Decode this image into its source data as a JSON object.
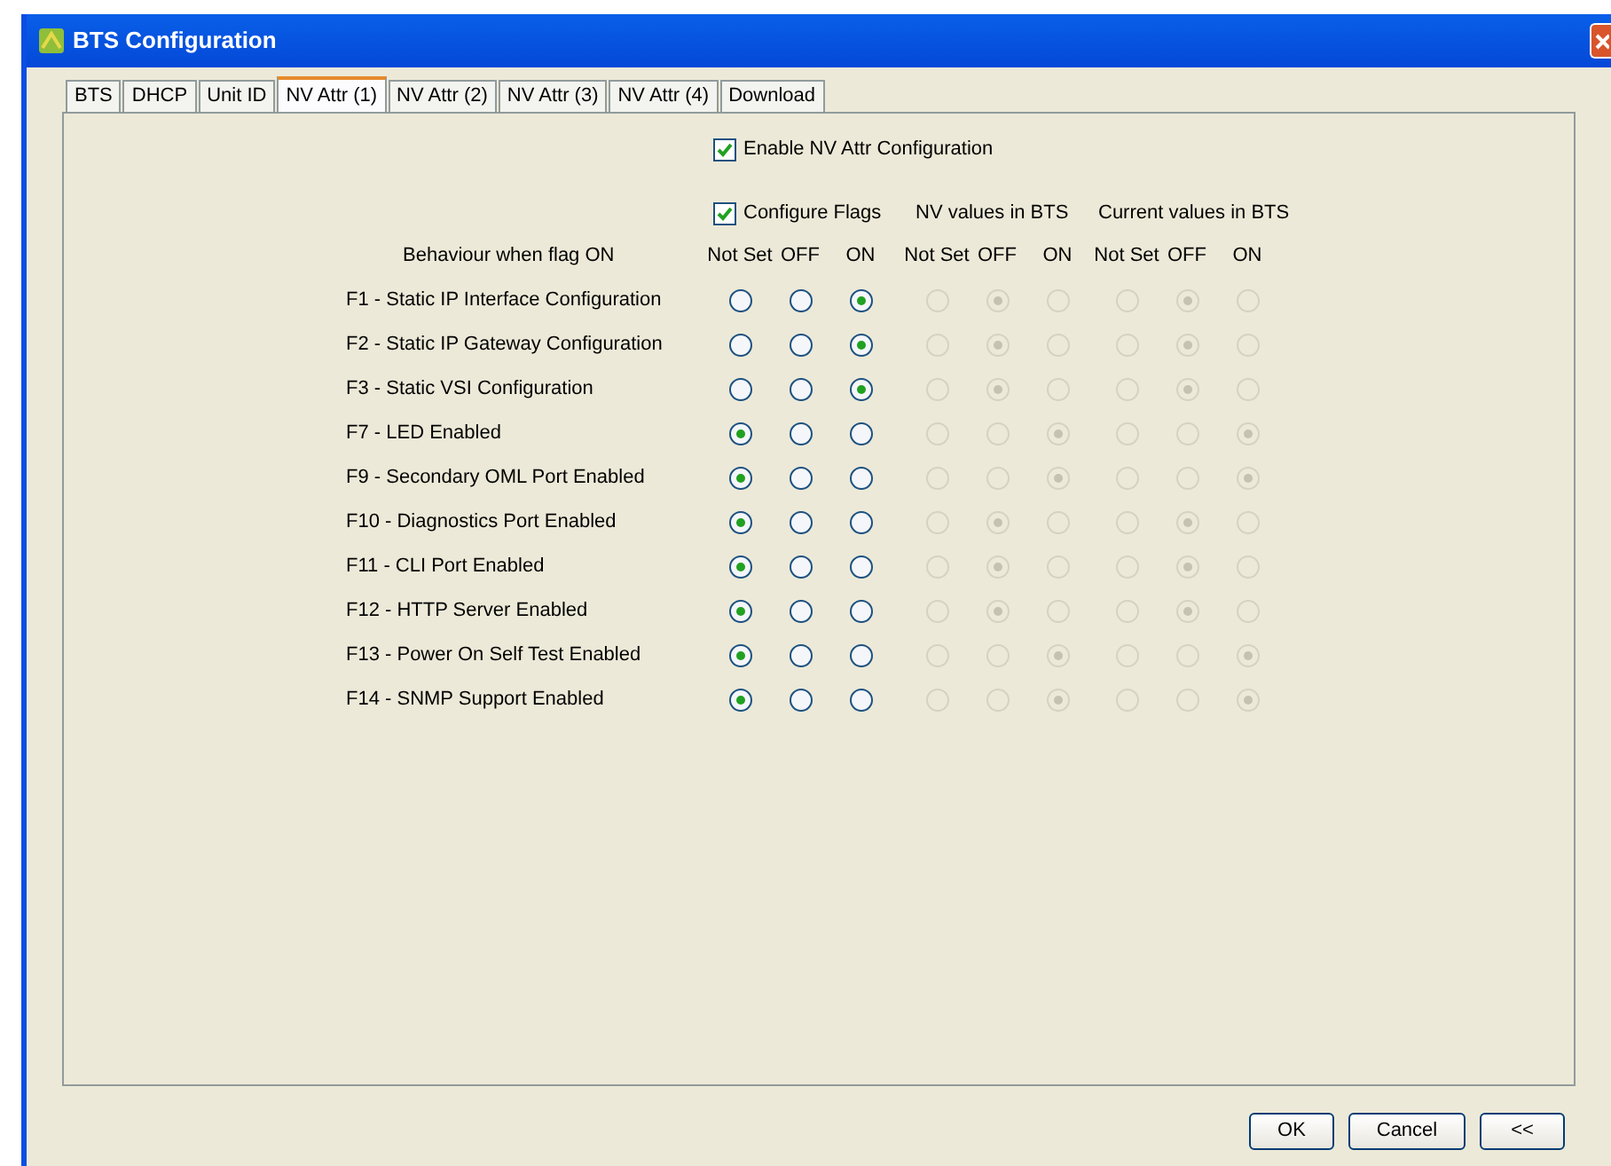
{
  "window": {
    "title": "BTS Configuration"
  },
  "tabs": [
    {
      "label": "BTS",
      "selected": false
    },
    {
      "label": "DHCP",
      "selected": false
    },
    {
      "label": "Unit ID",
      "selected": false
    },
    {
      "label": "NV Attr (1)",
      "selected": true
    },
    {
      "label": "NV Attr (2)",
      "selected": false
    },
    {
      "label": "NV Attr (3)",
      "selected": false
    },
    {
      "label": "NV Attr (4)",
      "selected": false
    },
    {
      "label": "Download",
      "selected": false
    }
  ],
  "enable_checkbox": {
    "label": "Enable NV Attr Configuration",
    "checked": true
  },
  "row_header": "Behaviour when flag ON",
  "column_groups": [
    {
      "kind": "checkbox",
      "title": "Configure Flags",
      "checked": true,
      "options": [
        "Not Set",
        "OFF",
        "ON"
      ]
    },
    {
      "kind": "text",
      "title": "NV values in BTS",
      "options": [
        "Not Set",
        "OFF",
        "ON"
      ]
    },
    {
      "kind": "text",
      "title": "Current values in BTS",
      "options": [
        "Not Set",
        "OFF",
        "ON"
      ]
    }
  ],
  "flags": [
    {
      "label": "F1 - Static IP Interface Configuration",
      "groups": [
        {
          "disabled": false,
          "radios": [
            {
              "selected": false
            },
            {
              "selected": false
            },
            {
              "selected": true
            }
          ]
        },
        {
          "disabled": true,
          "radios": [
            {
              "selected": false
            },
            {
              "selected": true
            },
            {
              "selected": false
            }
          ]
        },
        {
          "disabled": true,
          "radios": [
            {
              "selected": false
            },
            {
              "selected": true
            },
            {
              "selected": false
            }
          ]
        }
      ]
    },
    {
      "label": "F2 - Static IP Gateway Configuration",
      "groups": [
        {
          "disabled": false,
          "radios": [
            {
              "selected": false
            },
            {
              "selected": false
            },
            {
              "selected": true
            }
          ]
        },
        {
          "disabled": true,
          "radios": [
            {
              "selected": false
            },
            {
              "selected": true
            },
            {
              "selected": false
            }
          ]
        },
        {
          "disabled": true,
          "radios": [
            {
              "selected": false
            },
            {
              "selected": true
            },
            {
              "selected": false
            }
          ]
        }
      ]
    },
    {
      "label": "F3 - Static VSI Configuration",
      "groups": [
        {
          "disabled": false,
          "radios": [
            {
              "selected": false
            },
            {
              "selected": false
            },
            {
              "selected": true
            }
          ]
        },
        {
          "disabled": true,
          "radios": [
            {
              "selected": false
            },
            {
              "selected": true
            },
            {
              "selected": false
            }
          ]
        },
        {
          "disabled": true,
          "radios": [
            {
              "selected": false
            },
            {
              "selected": true
            },
            {
              "selected": false
            }
          ]
        }
      ]
    },
    {
      "label": "F7 - LED Enabled",
      "groups": [
        {
          "disabled": false,
          "radios": [
            {
              "selected": true
            },
            {
              "selected": false
            },
            {
              "selected": false
            }
          ]
        },
        {
          "disabled": true,
          "radios": [
            {
              "selected": false
            },
            {
              "selected": false
            },
            {
              "selected": true
            }
          ]
        },
        {
          "disabled": true,
          "radios": [
            {
              "selected": false
            },
            {
              "selected": false
            },
            {
              "selected": true
            }
          ]
        }
      ]
    },
    {
      "label": "F9 - Secondary OML Port Enabled",
      "groups": [
        {
          "disabled": false,
          "radios": [
            {
              "selected": true
            },
            {
              "selected": false
            },
            {
              "selected": false
            }
          ]
        },
        {
          "disabled": true,
          "radios": [
            {
              "selected": false
            },
            {
              "selected": false
            },
            {
              "selected": true
            }
          ]
        },
        {
          "disabled": true,
          "radios": [
            {
              "selected": false
            },
            {
              "selected": false
            },
            {
              "selected": true
            }
          ]
        }
      ]
    },
    {
      "label": "F10 - Diagnostics Port Enabled",
      "groups": [
        {
          "disabled": false,
          "radios": [
            {
              "selected": true
            },
            {
              "selected": false
            },
            {
              "selected": false
            }
          ]
        },
        {
          "disabled": true,
          "radios": [
            {
              "selected": false
            },
            {
              "selected": true
            },
            {
              "selected": false
            }
          ]
        },
        {
          "disabled": true,
          "radios": [
            {
              "selected": false
            },
            {
              "selected": true
            },
            {
              "selected": false
            }
          ]
        }
      ]
    },
    {
      "label": "F11 - CLI Port Enabled",
      "groups": [
        {
          "disabled": false,
          "radios": [
            {
              "selected": true
            },
            {
              "selected": false
            },
            {
              "selected": false
            }
          ]
        },
        {
          "disabled": true,
          "radios": [
            {
              "selected": false
            },
            {
              "selected": true
            },
            {
              "selected": false
            }
          ]
        },
        {
          "disabled": true,
          "radios": [
            {
              "selected": false
            },
            {
              "selected": true
            },
            {
              "selected": false
            }
          ]
        }
      ]
    },
    {
      "label": "F12 - HTTP Server Enabled",
      "groups": [
        {
          "disabled": false,
          "radios": [
            {
              "selected": true
            },
            {
              "selected": false
            },
            {
              "selected": false
            }
          ]
        },
        {
          "disabled": true,
          "radios": [
            {
              "selected": false
            },
            {
              "selected": true
            },
            {
              "selected": false
            }
          ]
        },
        {
          "disabled": true,
          "radios": [
            {
              "selected": false
            },
            {
              "selected": true
            },
            {
              "selected": false
            }
          ]
        }
      ]
    },
    {
      "label": "F13 - Power On Self Test Enabled",
      "groups": [
        {
          "disabled": false,
          "radios": [
            {
              "selected": true
            },
            {
              "selected": false
            },
            {
              "selected": false
            }
          ]
        },
        {
          "disabled": true,
          "radios": [
            {
              "selected": false
            },
            {
              "selected": false
            },
            {
              "selected": true
            }
          ]
        },
        {
          "disabled": true,
          "radios": [
            {
              "selected": false
            },
            {
              "selected": false
            },
            {
              "selected": true
            }
          ]
        }
      ]
    },
    {
      "label": "F14 - SNMP Support Enabled",
      "groups": [
        {
          "disabled": false,
          "radios": [
            {
              "selected": true
            },
            {
              "selected": false
            },
            {
              "selected": false
            }
          ]
        },
        {
          "disabled": true,
          "radios": [
            {
              "selected": false
            },
            {
              "selected": false
            },
            {
              "selected": true
            }
          ]
        },
        {
          "disabled": true,
          "radios": [
            {
              "selected": false
            },
            {
              "selected": false
            },
            {
              "selected": true
            }
          ]
        }
      ]
    }
  ],
  "buttons": [
    "OK",
    "Cancel",
    "<<"
  ]
}
